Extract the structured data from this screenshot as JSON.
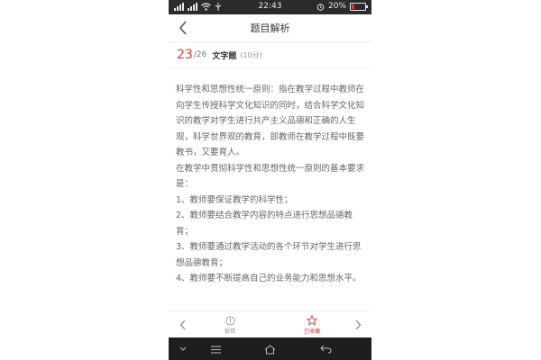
{
  "status_bar": {
    "time": "22:43",
    "battery": "20%",
    "battery_level": 0.2
  },
  "header": {
    "title": "题目解析"
  },
  "question": {
    "number": "23",
    "total": "/26",
    "type": "文字题",
    "score": "(10分)"
  },
  "content": {
    "paragraphs": [
      "科学性和思想性统一原则：指在教学过程中教师在向学生传授科学文化知识的同时，结合科学文化知识的教学对学生进行共产主义品德和正确的人生观，科学世界观的教育，即教师在教学过程中既要教书，又要育人。",
      "在教学中贯彻科学性和思想性统一原则的基本要求是：",
      "1、教师要保证教学的科学性；",
      "2、教师要结合教学内容的特点进行思想品德教育；",
      "3、教师要通过教学活动的各个环节对学生进行思想品德教育；",
      "4、教师要不断提高自己的业务能力和思想水平。"
    ]
  },
  "toolbar": {
    "report_label": "报错",
    "favorite_label": "已收藏"
  },
  "colors": {
    "accent": "#e0382b",
    "status_bar_bg": "#2b2b2b",
    "nav_bar_bg": "#1e1e1e"
  },
  "icons": {
    "back": "chevron-left-icon",
    "prev": "chevron-left-icon",
    "next": "chevron-right-icon",
    "report": "alert-circle-icon",
    "favorite": "star-icon"
  }
}
